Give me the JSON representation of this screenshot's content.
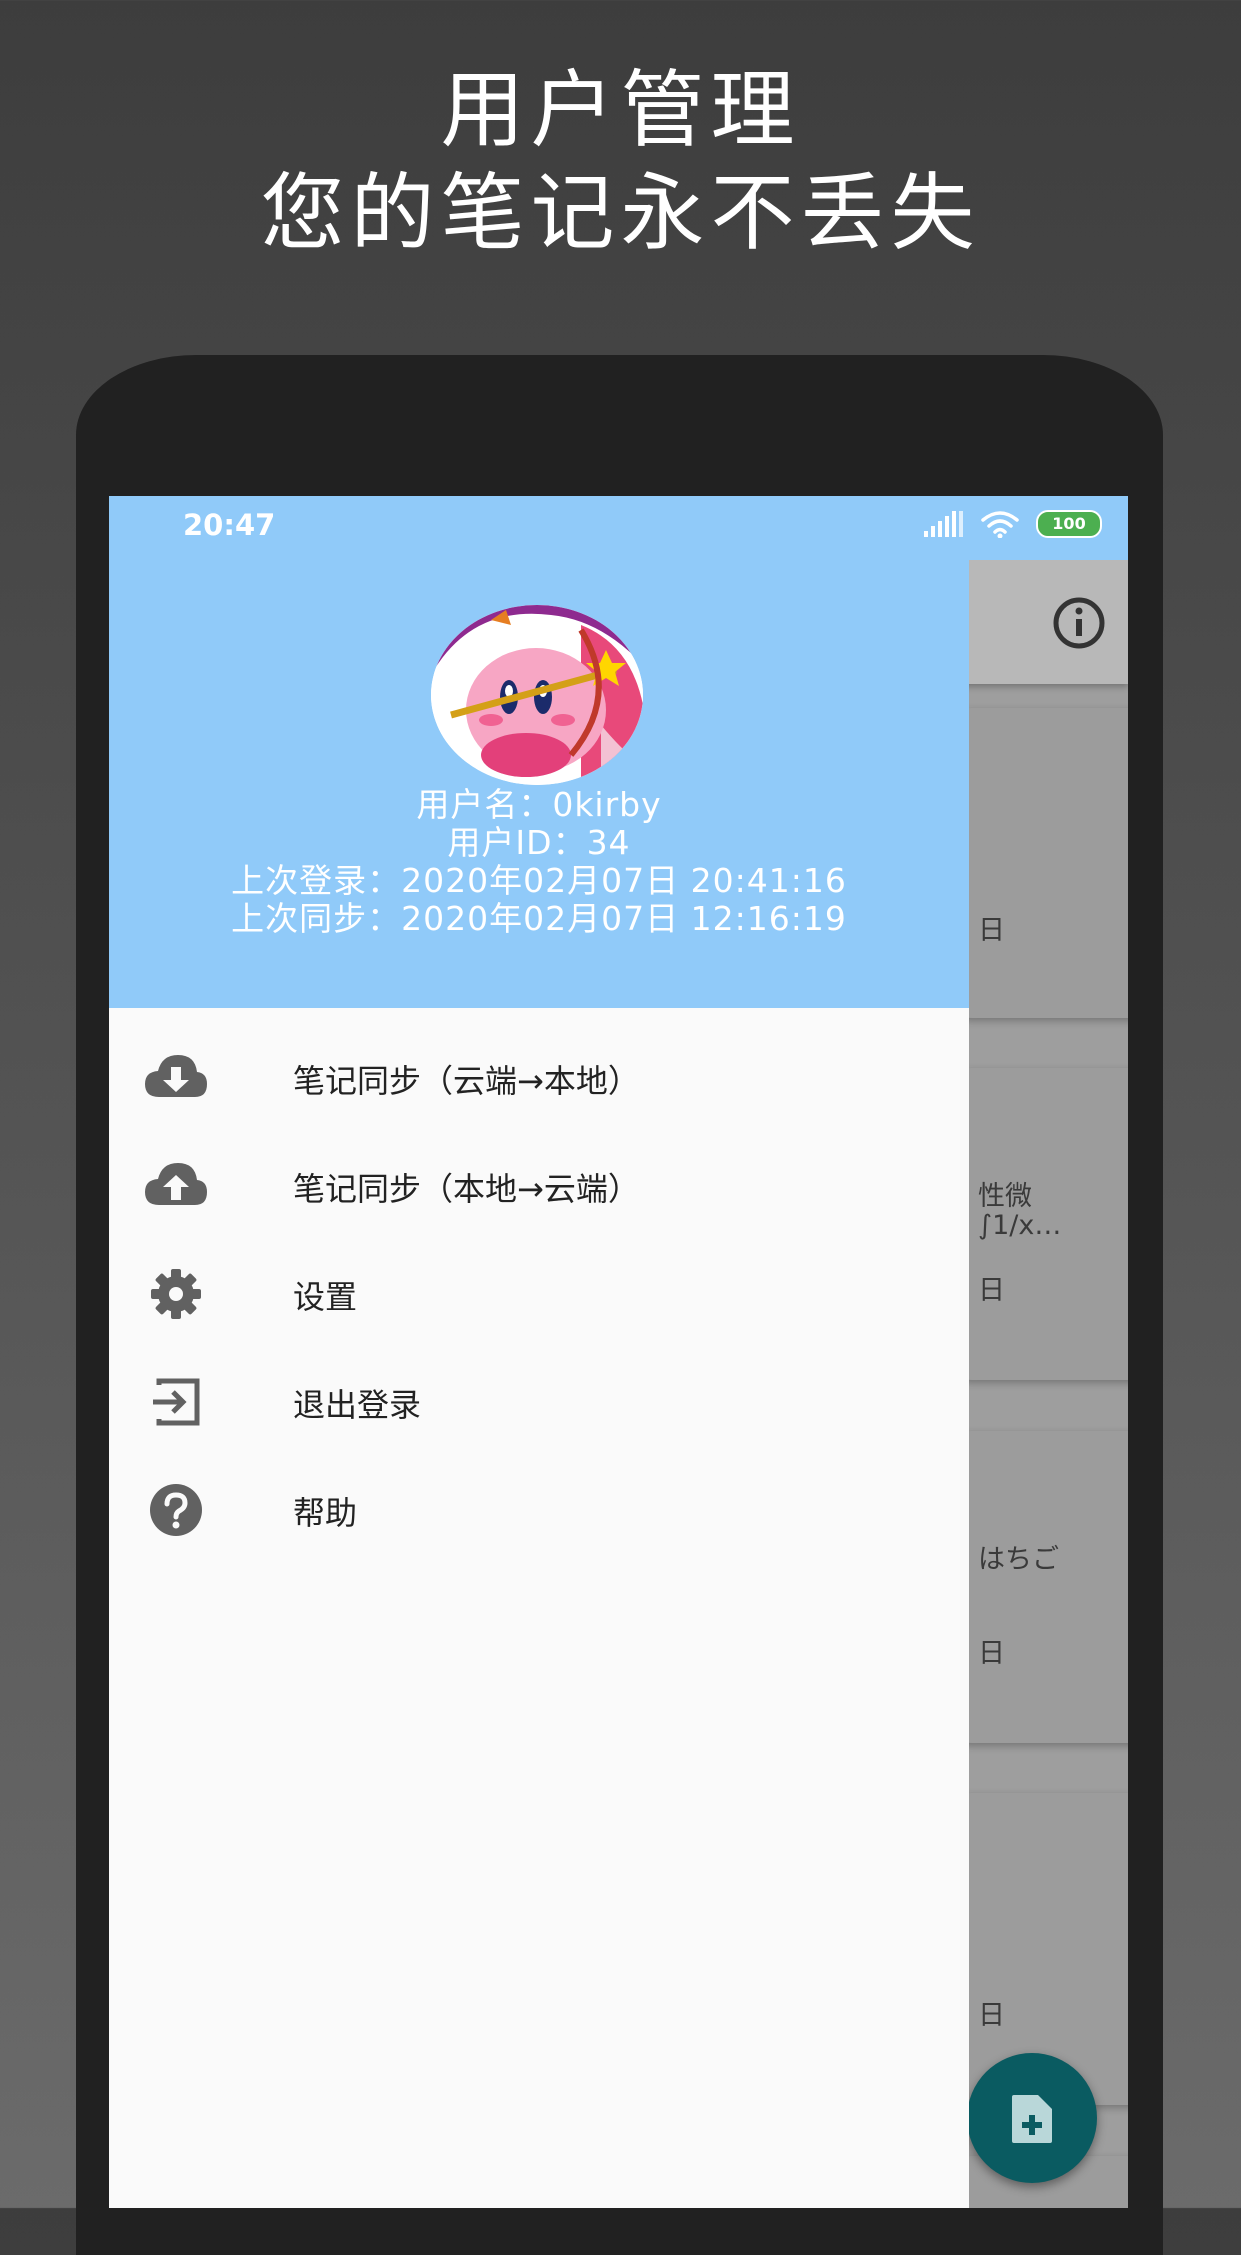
{
  "promo": {
    "line1": "用户管理",
    "line2": "您的笔记永不丢失"
  },
  "status_bar": {
    "time": "20:47",
    "battery": "100"
  },
  "drawer": {
    "username": "用户名：0kirby",
    "user_id": "用户ID：34",
    "last_login": "上次登录：2020年02月07日 20:41:16",
    "last_sync": "上次同步：2020年02月07日 12:16:19",
    "menu": [
      {
        "label": "笔记同步（云端→本地）",
        "icon": "cloud-download-icon"
      },
      {
        "label": "笔记同步（本地→云端）",
        "icon": "cloud-upload-icon"
      },
      {
        "label": "设置",
        "icon": "gear-icon"
      },
      {
        "label": "退出登录",
        "icon": "logout-icon"
      },
      {
        "label": "帮助",
        "icon": "help-icon"
      }
    ]
  },
  "background_notes": [
    {
      "line1": "",
      "line2": "",
      "date": "日"
    },
    {
      "line1": "性微",
      "line2": "∫1/x…",
      "date": "日"
    },
    {
      "line1": "はちご",
      "line2": "",
      "date": "日"
    },
    {
      "line1": "",
      "line2": "",
      "date": "日"
    }
  ],
  "colors": {
    "header": "#90caf9",
    "drawer": "#fafafa",
    "fab": "#0a5b61",
    "icon": "#616161"
  }
}
